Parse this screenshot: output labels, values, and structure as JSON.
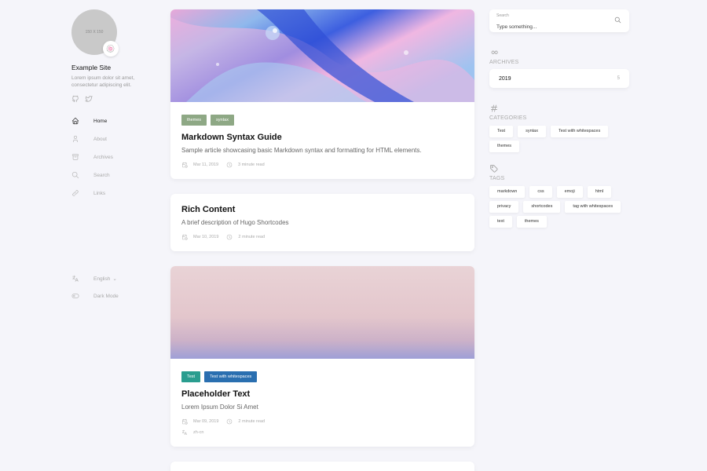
{
  "profile": {
    "avatar_text": "150 X 150",
    "avatar_emoji": "🍥",
    "site_name": "Example Site",
    "site_desc": "Lorem ipsum dolor sit amet, consectetur adipiscing elit."
  },
  "menu": {
    "items": [
      {
        "label": "Home",
        "icon": "home-icon"
      },
      {
        "label": "About",
        "icon": "user-icon"
      },
      {
        "label": "Archives",
        "icon": "archive-icon"
      },
      {
        "label": "Search",
        "icon": "search-icon"
      },
      {
        "label": "Links",
        "icon": "link-icon"
      }
    ]
  },
  "bottom_menu": {
    "language": "English",
    "dark_mode": "Dark Mode"
  },
  "posts": [
    {
      "tags": [
        {
          "label": "themes",
          "color": "#8ea885"
        },
        {
          "label": "syntax",
          "color": "#8ea885"
        }
      ],
      "title": "Markdown Syntax Guide",
      "desc": "Sample article showcasing basic Markdown syntax and formatting for HTML elements.",
      "date": "Mar 11, 2019",
      "read": "3 minute read"
    },
    {
      "title": "Rich Content",
      "desc": "A brief description of Hugo Shortcodes",
      "date": "Mar 10, 2019",
      "read": "2 minute read"
    },
    {
      "tags": [
        {
          "label": "Test",
          "color": "#2a9d8f"
        },
        {
          "label": "Test with whitespaces",
          "color": "#2a6fb0"
        }
      ],
      "title": "Placeholder Text",
      "desc": "Lorem Ipsum Dolor Si Amet",
      "date": "Mar 09, 2019",
      "read": "2 minute read",
      "lang": "zh-cn"
    }
  ],
  "search": {
    "label": "Search",
    "placeholder": "Type something..."
  },
  "archives": {
    "title": "ARCHIVES",
    "year": "2019",
    "count": "5"
  },
  "categories": {
    "title": "CATEGORIES",
    "items": [
      "Test",
      "syntax",
      "Test with whitespaces",
      "themes"
    ]
  },
  "tags": {
    "title": "TAGS",
    "items": [
      "markdown",
      "css",
      "emoji",
      "html",
      "privacy",
      "shortcodes",
      "tag with whitespaces",
      "text",
      "themes"
    ]
  }
}
